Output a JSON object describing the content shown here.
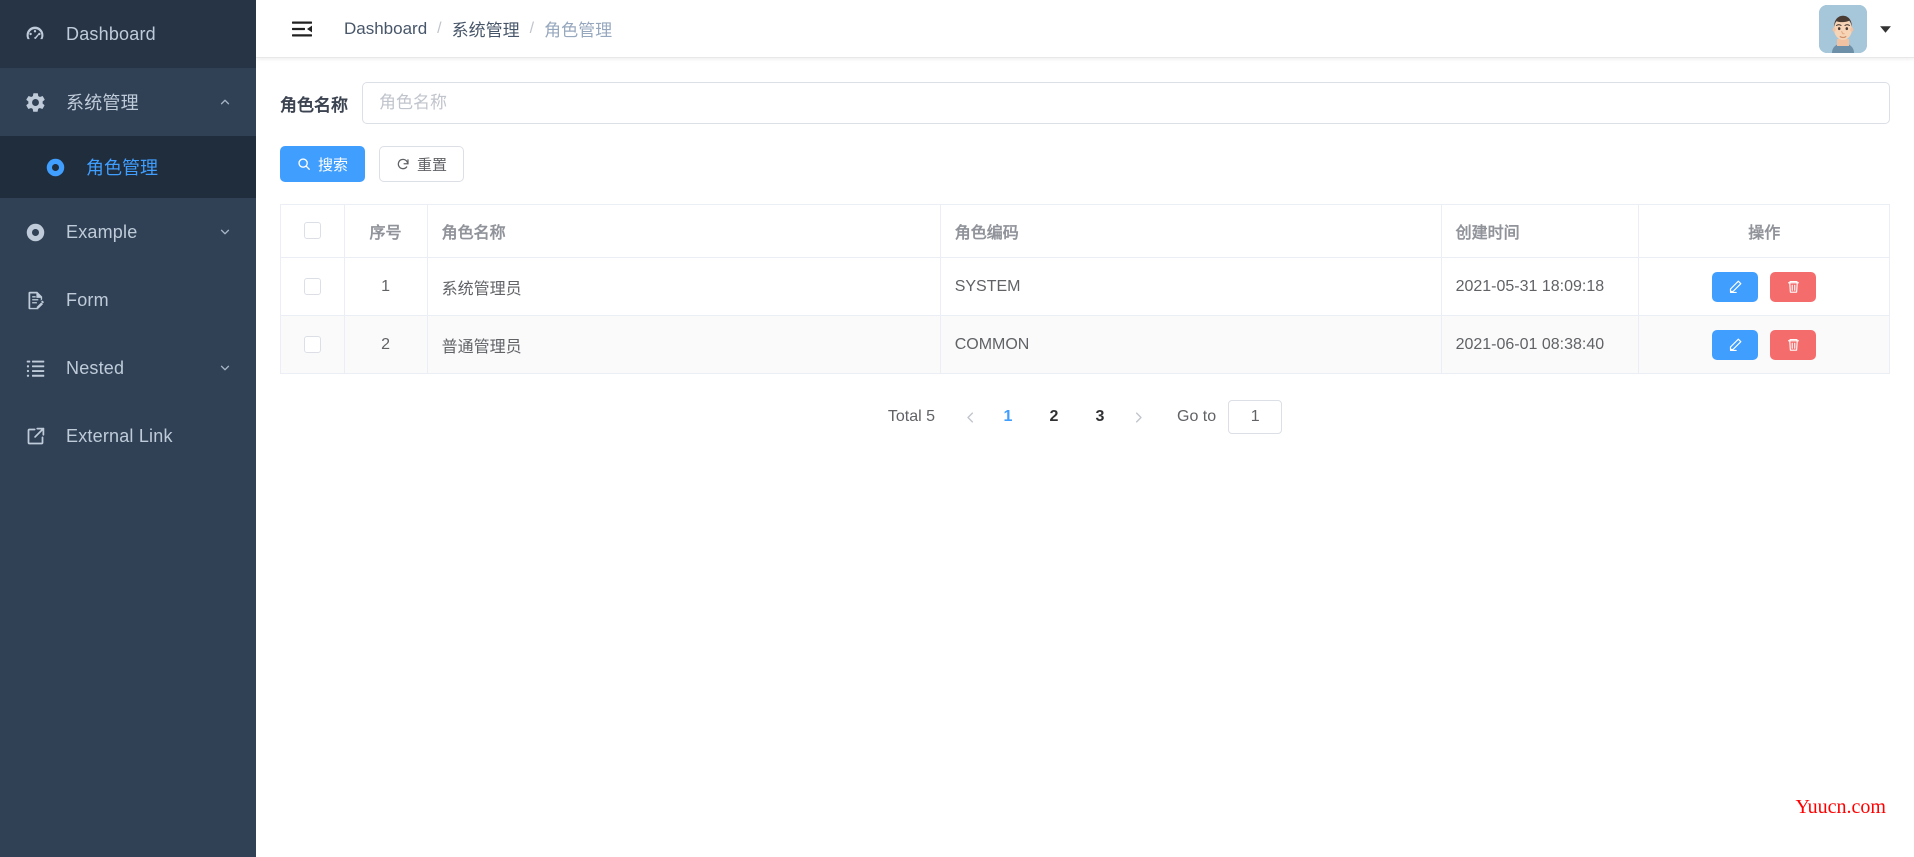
{
  "sidebar": {
    "bg_color": "#304156",
    "active_bg_color": "#1f2d3d",
    "active_text_color": "#409eff",
    "items": [
      {
        "label": "Dashboard",
        "icon": "dashboard-icon",
        "has_chevron": false,
        "expanded": false
      },
      {
        "label": "系统管理",
        "icon": "gear-icon",
        "has_chevron": true,
        "expanded": true
      },
      {
        "label": "Example",
        "icon": "target-icon",
        "has_chevron": true,
        "expanded": false
      },
      {
        "label": "Form",
        "icon": "form-icon",
        "has_chevron": false,
        "expanded": false
      },
      {
        "label": "Nested",
        "icon": "nested-list-icon",
        "has_chevron": true,
        "expanded": false
      },
      {
        "label": "External Link",
        "icon": "external-link-icon",
        "has_chevron": false,
        "expanded": false
      }
    ],
    "sub_items": [
      {
        "label": "角色管理",
        "icon": "target-icon",
        "active": true
      }
    ]
  },
  "navbar": {
    "hamburger_icon": "hamburger-collapse-icon",
    "breadcrumb": [
      {
        "label": "Dashboard",
        "current": false
      },
      {
        "label": "系统管理",
        "current": false
      },
      {
        "label": "角色管理",
        "current": true
      }
    ],
    "separator": "/",
    "avatar_icon": "user-avatar",
    "caret_icon": "caret-down-icon"
  },
  "filter": {
    "label": "角色名称",
    "input_value": "",
    "placeholder": "角色名称",
    "search_label": "搜索",
    "search_icon": "search-icon",
    "reset_label": "重置",
    "reset_icon": "refresh-icon",
    "primary_color": "#409eff"
  },
  "table": {
    "columns": [
      "",
      "序号",
      "角色名称",
      "角色编码",
      "创建时间",
      "操作"
    ],
    "rows": [
      {
        "index": "1",
        "name": "系统管理员",
        "code": "SYSTEM",
        "created": "2021-05-31 18:09:18",
        "edit_icon": "pencil-icon",
        "delete_icon": "trash-icon"
      },
      {
        "index": "2",
        "name": "普通管理员",
        "code": "COMMON",
        "created": "2021-06-01 08:38:40",
        "edit_icon": "pencil-icon",
        "delete_icon": "trash-icon"
      }
    ],
    "edit_color": "#409eff",
    "delete_color": "#f56c6c"
  },
  "pagination": {
    "total_label": "Total 5",
    "prev_icon": "chevron-left-icon",
    "next_icon": "chevron-right-icon",
    "pages": [
      "1",
      "2",
      "3"
    ],
    "active_page": "1",
    "goto_label": "Go to",
    "goto_value": "1"
  },
  "watermark": {
    "text": "Yuucn.com",
    "color": "#ff0000"
  }
}
